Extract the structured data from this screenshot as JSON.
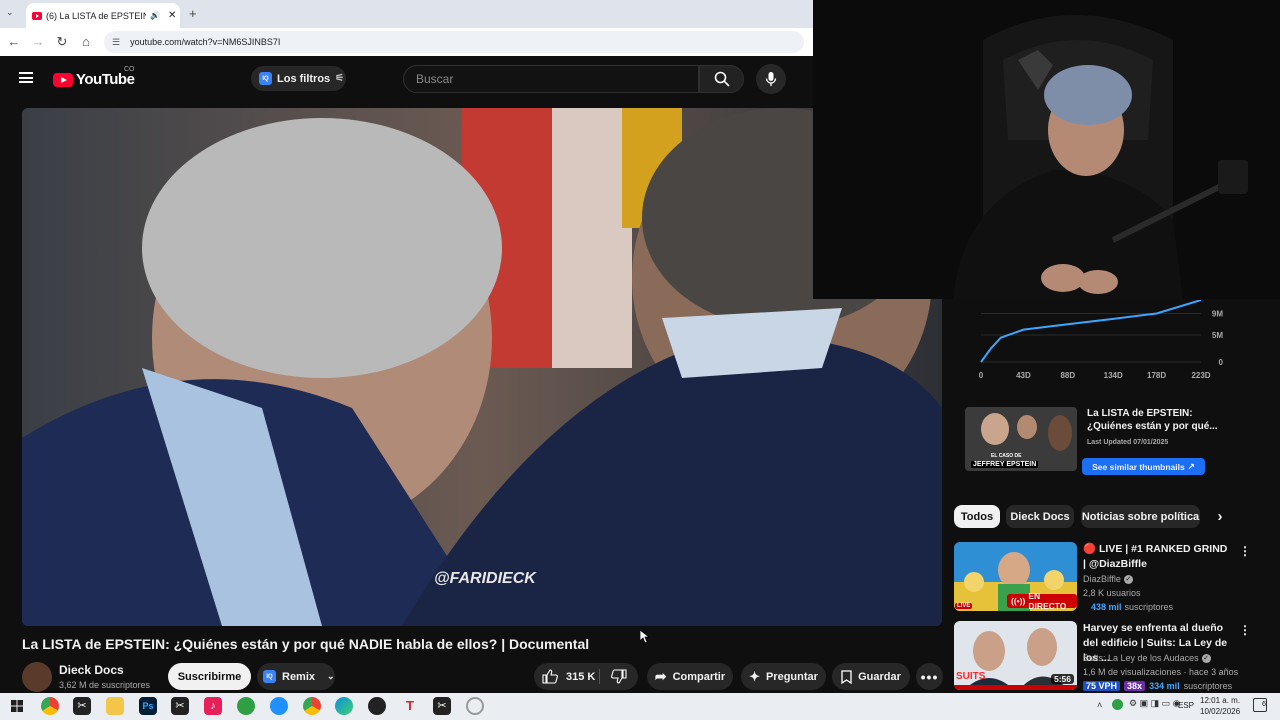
{
  "browser": {
    "tab_title": "(6) La LISTA de EPSTEIN: ¿Q",
    "url": "youtube.com/watch?v=NM6SJINBS7I"
  },
  "youtube": {
    "logo_text": "YouTube",
    "country": "CO",
    "filters_label": "Los filtros",
    "iq_badge": "IQ",
    "search_placeholder": "Buscar"
  },
  "video": {
    "watermark": "@FARIDIECK",
    "title": "La LISTA de EPSTEIN: ¿Quiénes están y por qué NADIE habla de ellos? | Documental",
    "channel": "Dieck Docs",
    "subscribers": "3,62 M de suscriptores",
    "subscribe_label": "Suscribirme",
    "remix_label": "Remix",
    "likes": "315 K",
    "share_label": "Compartir",
    "ask_label": "Preguntar",
    "save_label": "Guardar"
  },
  "chart_data": {
    "type": "line",
    "x_ticks": [
      "0",
      "43D",
      "88D",
      "134D",
      "178D",
      "223D"
    ],
    "y_ticks": [
      "9M",
      "5M",
      "0"
    ],
    "x": [
      0,
      10,
      20,
      43,
      88,
      134,
      178,
      223
    ],
    "y": [
      0,
      2.5,
      4.5,
      6.0,
      7.0,
      8.0,
      9.0,
      11.5
    ]
  },
  "thumb_card": {
    "title": "La LISTA de EPSTEIN: ¿Quiénes están y por qué...",
    "updated": "Last Updated 07/01/2025",
    "button": "See similar thumbnails",
    "thumb_text_1": "EL CASO DE",
    "thumb_text_2": "JEFFREY EPSTEIN"
  },
  "chips": [
    "Todos",
    "Dieck Docs",
    "Noticias sobre política"
  ],
  "recommendations": [
    {
      "title": "🔴 LIVE | #1 RANKED GRIND | @DiazBiffle",
      "channel": "DiazBiffle",
      "meta": "2,8 K usuarios",
      "badge": "EN DIRECTO",
      "live_tag": "LIVE",
      "subs_value": "438 mil",
      "subs_word": "suscriptores"
    },
    {
      "title": "Harvey se enfrenta al dueño del edificio | Suits: La Ley de los ...",
      "channel": "Suits: La Ley de los Audaces",
      "meta": "1,6 M de visualizaciones · hace 3 años",
      "duration": "5:56",
      "thumb_text": "SUITS",
      "vph": "75 VPH",
      "multiplier": "38x",
      "subs_value": "334 mil",
      "subs_word": "suscriptores"
    }
  ],
  "taskbar": {
    "time": "12:01 a. m.",
    "date": "10/02/2026",
    "lang": "ESP",
    "notif_count": "6"
  },
  "colors": {
    "youtube_red": "#ff0033",
    "accent_blue": "#3ea6ff",
    "background": "#0f0f0f"
  }
}
